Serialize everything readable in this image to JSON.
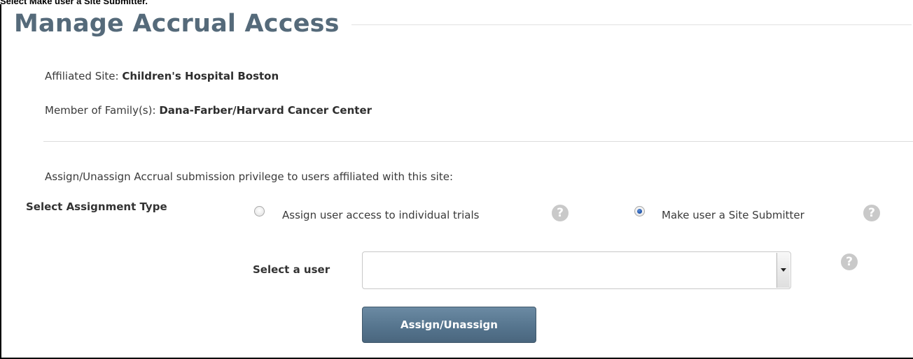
{
  "caption": "Select Make user a Site Submitter.",
  "page": {
    "title": "Manage Accrual Access"
  },
  "site_info": {
    "affiliated_site_label": "Affiliated Site: ",
    "affiliated_site_value": "Children's Hospital Boston",
    "family_label": "Member of Family(s): ",
    "family_value": "Dana-Farber/Harvard Cancer Center"
  },
  "instruction": "Assign/Unassign Accrual submission privilege to users affiliated with this site:",
  "assignment": {
    "label": "Select Assignment Type",
    "options": [
      {
        "label": "Assign user access to individual trials",
        "selected": false
      },
      {
        "label": "Make user a Site Submitter",
        "selected": true
      }
    ],
    "help_glyph": "?"
  },
  "user_select": {
    "label": "Select a user",
    "value": ""
  },
  "submit_button": {
    "label": "Assign/Unassign"
  },
  "colors": {
    "title": "#556a7a",
    "button": "#56758e",
    "help_icon": "#c9c9c9",
    "radio_selected": "#1a4ea5"
  },
  "icons": [
    "help-icon",
    "chevron-down-icon"
  ]
}
